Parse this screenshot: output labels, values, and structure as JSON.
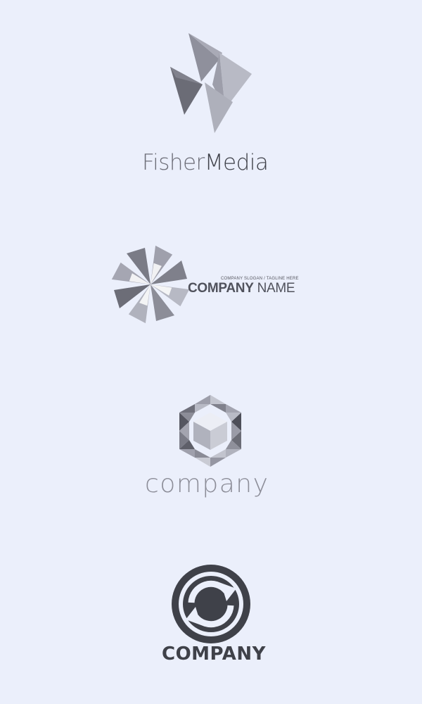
{
  "colors": {
    "background": "#ebeffb",
    "dark_gray": "#3f4149",
    "mid_gray": "#6d6e78",
    "light_gray": "#b4b6c1",
    "pale_gray": "#d4d6df"
  },
  "logos": [
    {
      "icon": "triangles-bird-icon",
      "text_part1": "Fisher",
      "text_part2": "Media"
    },
    {
      "icon": "pinwheel-icon",
      "slogan": "COMPANY SLOGAN / TAGLINE HERE",
      "name_part1": "COMPANY",
      "name_part2": " NAME"
    },
    {
      "icon": "hexagon-cube-icon",
      "text": "company"
    },
    {
      "icon": "circular-arrows-icon",
      "text": "COMPANY"
    }
  ]
}
